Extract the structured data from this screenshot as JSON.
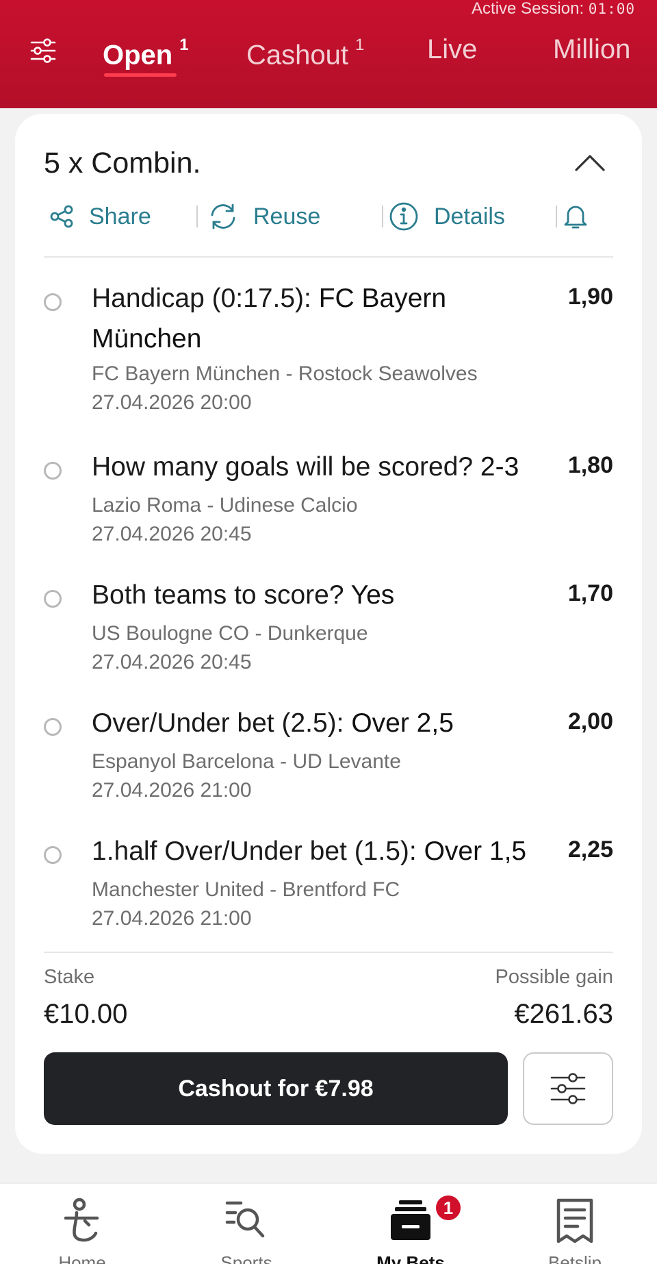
{
  "header": {
    "session_label": "Active Session:",
    "session_timer": "01:00",
    "tabs": [
      {
        "label": "Open",
        "count": "1"
      },
      {
        "label": "Cashout",
        "count": "1"
      },
      {
        "label": "Live"
      },
      {
        "label": "Million"
      }
    ]
  },
  "bet": {
    "title": "5 x Combin.",
    "actions": {
      "share": "Share",
      "reuse": "Reuse",
      "details": "Details"
    },
    "selections": [
      {
        "market": "Handicap (0:17.5): ",
        "pick": "FC Bayern München",
        "odds": "1,90",
        "event": "FC Bayern München - Rostock Seawolves",
        "time": "27.04.2026 20:00"
      },
      {
        "market": "How many goals will be scored? ",
        "pick": "2-3",
        "odds": "1,80",
        "event": "Lazio Roma - Udinese Calcio",
        "time": "27.04.2026 20:45"
      },
      {
        "market": "Both teams to score? ",
        "pick": "Yes",
        "odds": "1,70",
        "event": "US Boulogne CO - Dunkerque",
        "time": "27.04.2026 20:45"
      },
      {
        "market": "Over/Under bet (2.5): ",
        "pick": "Over 2,5",
        "odds": "2,00",
        "event": "Espanyol Barcelona - UD Levante",
        "time": "27.04.2026 21:00"
      },
      {
        "market": "1.half Over/Under bet (1.5): ",
        "pick": "Over 1,5",
        "odds": "2,25",
        "event": "Manchester United - Brentford FC",
        "time": "27.04.2026 21:00"
      }
    ],
    "stake_label": "Stake",
    "stake_value": "€10.00",
    "gain_label": "Possible gain",
    "gain_value": "€261.63",
    "cashout_label": "Cashout for €7.98"
  },
  "nav": {
    "items": [
      {
        "label": "Home",
        "icon": "home-icon"
      },
      {
        "label": "Sports",
        "icon": "sports-search-icon"
      },
      {
        "label": "My Bets",
        "icon": "my-bets-icon",
        "badge": "1"
      },
      {
        "label": "Betslip",
        "icon": "betslip-icon"
      }
    ]
  },
  "colors": {
    "brand_red": "#c8102e",
    "accent_teal": "#2a7d8f",
    "dark_button": "#222326"
  }
}
